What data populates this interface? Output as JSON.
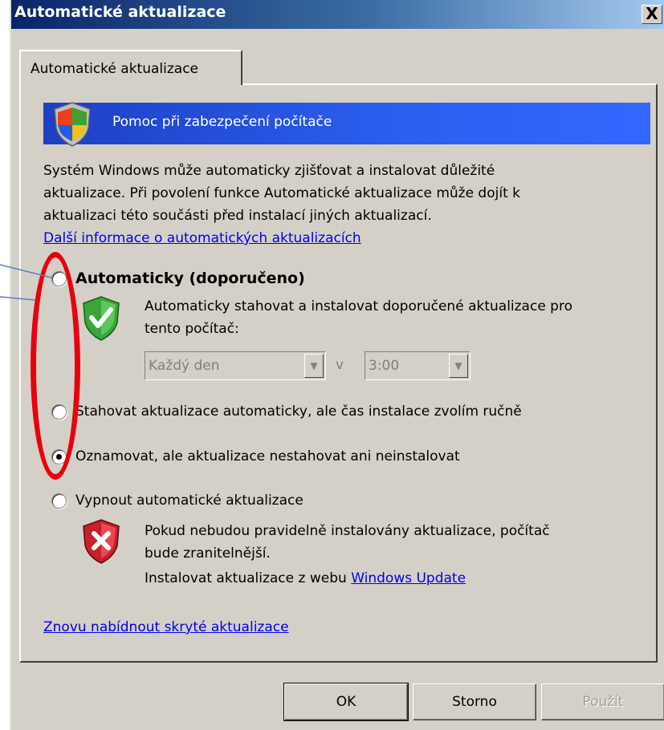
{
  "window": {
    "title": "Automatické aktualizace",
    "close_label": "X"
  },
  "tab": {
    "label": "Automatické aktualizace"
  },
  "banner": {
    "text": "Pomoc při zabezpečení počítače",
    "icon": "windows-security-shield-icon"
  },
  "intro": {
    "lines": [
      "Systém Windows může automaticky zjišťovat a instalovat důležité",
      "aktualizace. Při povolení funkce Automatické aktualizace může dojít k",
      "aktualizaci této součásti před instalací jiných aktualizací."
    ],
    "link": "Další informace o automatických aktualizacích"
  },
  "options": {
    "automatic": {
      "label": "Automaticky (doporučeno)",
      "selected": false,
      "desc_lines": [
        "Automaticky stahovat a instalovat doporučené aktualizace pro",
        "tento počítač:"
      ],
      "icon": "green-check-shield-icon",
      "day_value": "Každý den",
      "at_label": "v",
      "time_value": "3:00"
    },
    "download": {
      "label": "Stahovat aktualizace automaticky, ale čas instalace zvolím ručně",
      "selected": false
    },
    "notify": {
      "label": "Oznamovat, ale aktualizace nestahovat ani neinstalovat",
      "selected": true
    },
    "off": {
      "label": "Vypnout automatické aktualizace",
      "selected": false,
      "icon": "red-x-shield-icon",
      "warning_lines": [
        "Pokud nebudou pravidelně instalovány aktualizace, počítač",
        "bude zranitelnější."
      ],
      "install_prefix": "Instalovat aktualizace z webu",
      "install_link": "Windows Update"
    }
  },
  "hidden_link": "Znovu nabídnout skryté aktualizace",
  "buttons": {
    "ok": "OK",
    "cancel": "Storno",
    "apply": "Použít"
  },
  "colors": {
    "title_bar": "#0a246a",
    "banner": "#2a60f0",
    "annotation": "#e8000e",
    "link": "#0000ee"
  }
}
